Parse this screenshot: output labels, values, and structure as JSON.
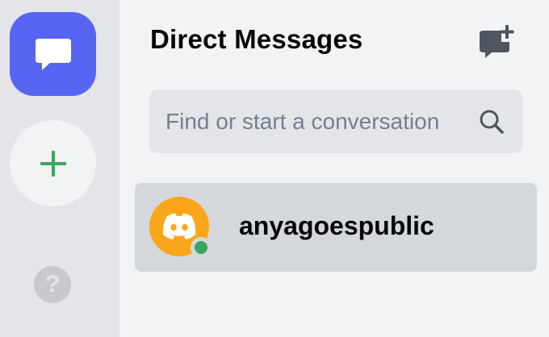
{
  "colors": {
    "accent": "#5865f2",
    "add_green": "#3ba55c",
    "avatar_bg": "#faa61a",
    "status_online": "#3ba55c"
  },
  "rail": {
    "home_icon": "chat-bubble-icon",
    "add_icon": "plus-icon",
    "help_icon": "question-icon",
    "help_glyph": "?"
  },
  "header": {
    "title": "Direct Messages",
    "new_dm_icon": "new-dm-icon"
  },
  "search": {
    "placeholder": "Find or start a conversation",
    "icon": "search-icon"
  },
  "conversations": [
    {
      "username": "anyagoespublic",
      "avatar_icon": "discord-logo-icon",
      "status": "online"
    }
  ]
}
